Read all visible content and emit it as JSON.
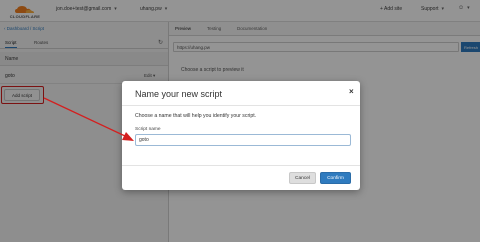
{
  "nav": {
    "logo_text": "CLOUDFLARE",
    "account": "jon.doe+test@gmail.com",
    "domain": "uhang.pw",
    "add_site": "+ Add site",
    "support": "Support",
    "user": "☺"
  },
  "left": {
    "breadcrumb": "‹ Dashboard / Script",
    "tabs": [
      "Script",
      "Routes"
    ],
    "column_header": "Name",
    "scripts": [
      {
        "name": "goto",
        "edit": "Edit ▾"
      }
    ],
    "add_script_label": "Add script"
  },
  "right": {
    "tabs": [
      "Preview",
      "Testing",
      "Documentation"
    ],
    "url_value": "https://uhang.pw",
    "url_button": "Refresh",
    "empty_message": "Choose a script to preview it"
  },
  "modal": {
    "title": "Name your new script",
    "close_glyph": "×",
    "description": "Choose a name that will help you identify your script.",
    "field_label": "Script name",
    "field_value": "goto",
    "cancel_label": "Cancel",
    "confirm_label": "Confirm"
  },
  "colors": {
    "accent": "#2f7bbf",
    "annotation": "#d41f1f",
    "logo_orange": "#f38020"
  }
}
